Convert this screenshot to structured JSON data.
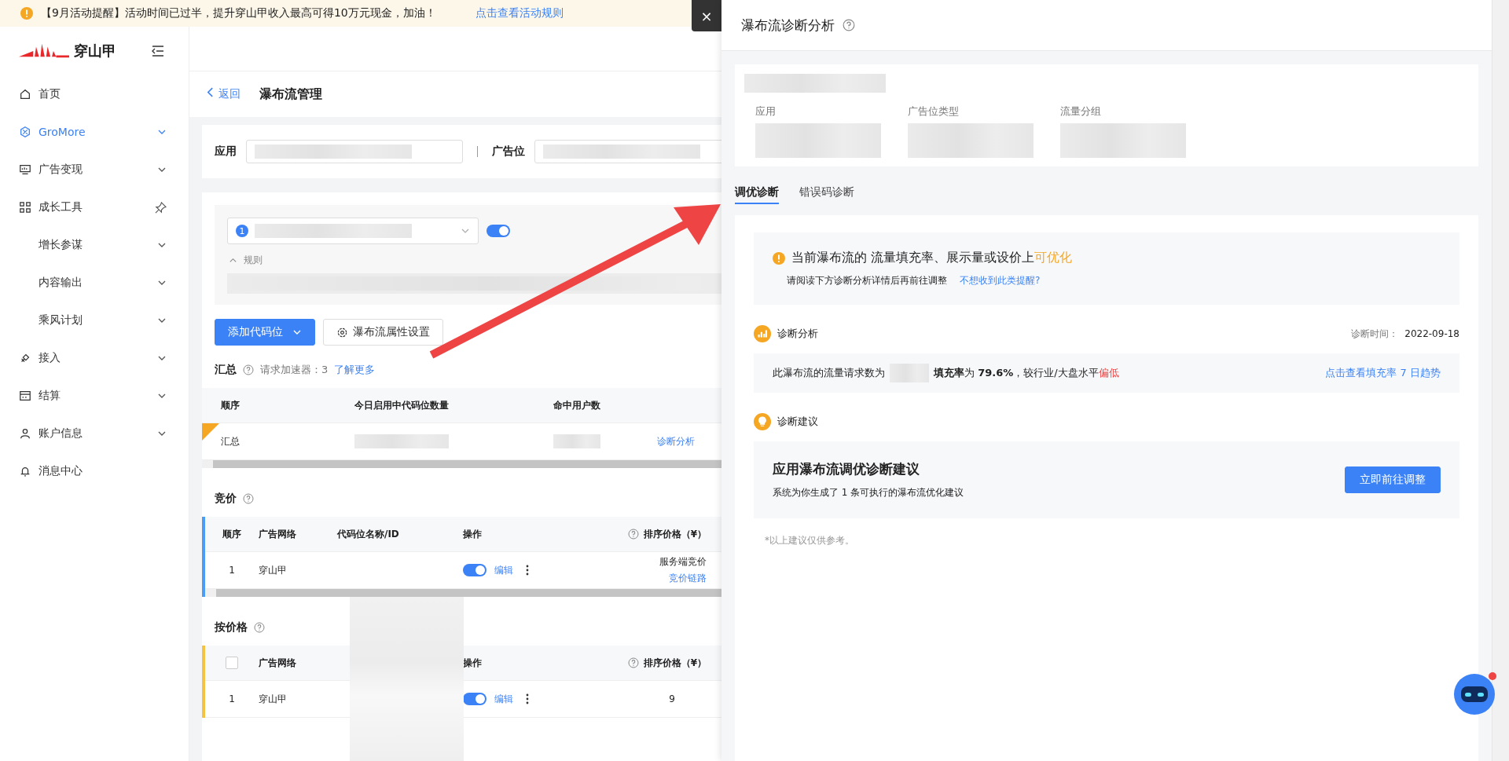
{
  "banner": {
    "text": "【9月活动提醒】活动时间已过半，提升穿山甲收入最高可得10万元现金，加油！",
    "link": "点击查看活动规则"
  },
  "close_button": "×",
  "sidebar": {
    "logo": "穿山甲",
    "items": [
      {
        "label": "首页",
        "kind": "none",
        "selected": false
      },
      {
        "label": "GroMore",
        "kind": "chevron",
        "selected": true
      },
      {
        "label": "广告变现",
        "kind": "chevron",
        "selected": false
      },
      {
        "label": "成长工具",
        "kind": "pin",
        "selected": false,
        "children": [
          {
            "label": "增长参谋",
            "kind": "chevron",
            "selected": false
          },
          {
            "label": "内容输出",
            "kind": "chevron",
            "selected": false
          },
          {
            "label": "乘风计划",
            "kind": "chevron",
            "selected": false
          }
        ]
      },
      {
        "label": "接入",
        "kind": "chevron",
        "selected": false
      },
      {
        "label": "结算",
        "kind": "chevron",
        "selected": false
      },
      {
        "label": "账户信息",
        "kind": "chevron",
        "selected": false
      },
      {
        "label": "消息中心",
        "kind": "none",
        "selected": false
      }
    ]
  },
  "breadcrumb": {
    "back": "返回",
    "title": "瀑布流管理"
  },
  "filters": [
    {
      "label": "应用"
    },
    {
      "label": "广告位"
    }
  ],
  "waterfall": {
    "step": "1",
    "on": true,
    "rules_label": "规则",
    "rules_expanded": true
  },
  "actions": {
    "primary": "添加代码位",
    "secondary": "瀑布流属性设置"
  },
  "summary": {
    "title": "汇总",
    "accelerator": "请求加速器：3",
    "link": "了解更多",
    "columns": [
      "顺序",
      "今日启用中代码位数量",
      "命中用户数"
    ],
    "row": {
      "name": "汇总",
      "warning": true,
      "link": "诊断分析"
    }
  },
  "bidding": {
    "title": "竞价",
    "columns": [
      "顺序",
      "广告网络",
      "代码位名称/ID",
      "操作",
      "排序价格（¥）"
    ],
    "rows": [
      {
        "order": "1",
        "network": "穿山甲",
        "on": true,
        "edit": "编辑",
        "price": "服务端竞价",
        "price_link": "竞价链路"
      }
    ]
  },
  "by_price": {
    "title": "按价格",
    "checked": false,
    "columns": [
      "广告网络",
      "操作",
      "排序价格（¥）"
    ],
    "rows": [
      {
        "order": "1",
        "network": "穿山甲",
        "on": true,
        "edit": "编辑",
        "price": "9"
      }
    ]
  },
  "drawer": {
    "title": "瀑布流诊断分析",
    "info_labels": [
      "应用",
      "广告位类型",
      "流量分组"
    ],
    "tabs": [
      {
        "label": "调优诊断",
        "selected": true
      },
      {
        "label": "错误码诊断",
        "selected": false
      }
    ],
    "alert": {
      "title": "当前瀑布流的 流量填充率、展示量或设价上",
      "highlight": "可优化",
      "subtitle": "请阅读下方诊断分析详情后再前往调整",
      "link": "不想收到此类提醒?"
    },
    "analysis": {
      "heading": "诊断分析",
      "time_label": "诊断时间：",
      "time": "2022-09-18",
      "text_before": "此瀑布流的流量请求数为",
      "text_after": "**填充率**为 **79.6%**，较行业/大盘水平",
      "verdict": "偏低",
      "link": "点击查看填充率 7 日趋势"
    },
    "suggestion": {
      "heading": "诊断建议",
      "title": "应用瀑布流调优诊断建议",
      "description": "系统为你生成了 1 条可执行的瀑布流优化建议",
      "button": "立即前往调整",
      "note": "*以上建议仅供参考。"
    }
  }
}
